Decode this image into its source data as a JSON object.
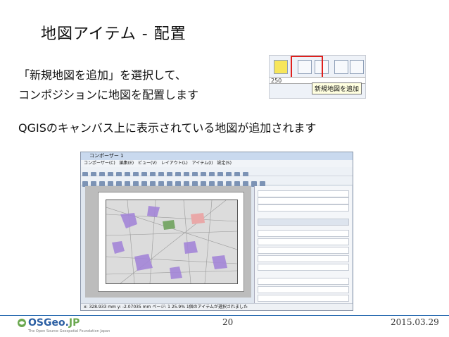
{
  "slide": {
    "title": "地図アイテム - 配置",
    "line1": "「新規地図を追加」を選択して、",
    "line2": "コンポジションに地図を配置します",
    "line3": "QGISのキャンバス上に表示されている地図が追加されます"
  },
  "toolbar_crop": {
    "ruler_label": "250",
    "tooltip": "新規地図を追加",
    "highlight_color": "#e0201c"
  },
  "composer": {
    "window_title": "コンポーザー 1",
    "menu": "コンポーザー(C)  編集(E)  ビュー(V)  レイアウト(L)  アイテム(I)  設定(S)",
    "status": "x: 328.933 mm   y: -2.07035 mm   ページ: 1   25.9%   1個のアイテムが選択されました"
  },
  "footer": {
    "logo_main": "OSGeo.",
    "logo_jp": "JP",
    "logo_sub": "The Open Source Geospatial Foundation Japan",
    "page_number": "20",
    "date": "2015.03.29"
  }
}
